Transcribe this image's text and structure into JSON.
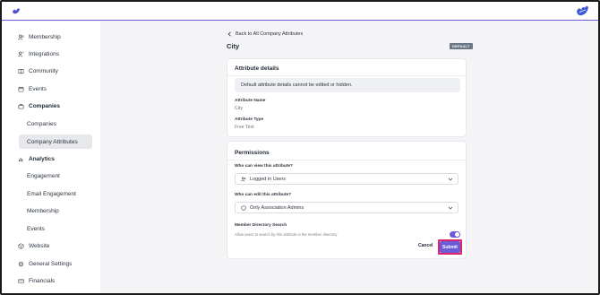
{
  "colors": {
    "accent": "#6b5bd6",
    "highlight": "#e0226a",
    "active_nav_bg": "#e6e8ec",
    "badge_bg": "#6b7785"
  },
  "topbar": {
    "left_logo": "brand-logo-icon",
    "right_logo": "brand-logo-icon"
  },
  "sidebar": {
    "items": [
      {
        "label": "Membership",
        "icon": "users-icon"
      },
      {
        "label": "Integrations",
        "icon": "integrations-icon"
      },
      {
        "label": "Community",
        "icon": "book-icon"
      },
      {
        "label": "Events",
        "icon": "calendar-icon"
      },
      {
        "label": "Companies",
        "icon": "briefcase-icon"
      },
      {
        "label": "Companies"
      },
      {
        "label": "Company Attributes"
      },
      {
        "label": "Analytics",
        "icon": "chart-icon"
      },
      {
        "label": "Engagement"
      },
      {
        "label": "Email Engagement"
      },
      {
        "label": "Membership"
      },
      {
        "label": "Events"
      },
      {
        "label": "Website",
        "icon": "globe-icon"
      },
      {
        "label": "General Settings",
        "icon": "gear-icon"
      },
      {
        "label": "Financials",
        "icon": "card-icon"
      }
    ]
  },
  "main": {
    "back_label": "Back to All Company Attributes",
    "title": "City",
    "badge": "DEFAULT",
    "details": {
      "heading": "Attribute details",
      "notice": "Default attribute details cannot be edited or hidden.",
      "name_label": "Attribute Name",
      "name_value": "City",
      "type_label": "Attribute Type",
      "type_value": "Free Text"
    },
    "permissions": {
      "heading": "Permissions",
      "view_label": "Who can view this attribute?",
      "view_value": "Logged in Users",
      "edit_label": "Who can edit this attribute?",
      "edit_value": "Only Association Admins",
      "directory_label": "Member Directory Search",
      "directory_help": "Allow users to search by this attribute in the member directory",
      "directory_enabled": true,
      "cancel_label": "Cancel",
      "submit_label": "Submit"
    }
  }
}
